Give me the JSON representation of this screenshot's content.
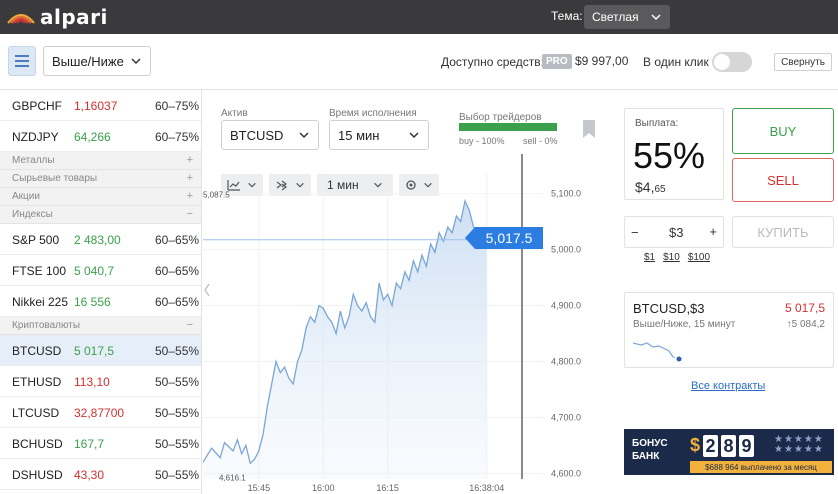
{
  "app": {
    "logo_text": "alpari",
    "theme_label": "Тема:",
    "theme_value": "Светлая"
  },
  "toolbar": {
    "mode_value": "Выше/Ниже",
    "funds_label": "Доступно средств:",
    "pro_badge": "PRO",
    "funds_value": "$9 997,00",
    "one_click_label": "В один клик",
    "one_click_enabled": false,
    "collapse_label": "Свернуть"
  },
  "assets": [
    {
      "type": "asset",
      "name": "GBPCHF",
      "price": "1,16037",
      "price_color": "red",
      "pct": "60–75%"
    },
    {
      "type": "asset",
      "name": "NZDJPY",
      "price": "64,266",
      "price_color": "green",
      "pct": "60–75%"
    },
    {
      "type": "category",
      "name": "Металлы",
      "sign": "+"
    },
    {
      "type": "category",
      "name": "Сырьевые товары",
      "sign": "+"
    },
    {
      "type": "category",
      "name": "Акции",
      "sign": "+"
    },
    {
      "type": "category",
      "name": "Индексы",
      "sign": "−"
    },
    {
      "type": "asset",
      "name": "S&P 500",
      "price": "2 483,00",
      "price_color": "green",
      "pct": "60–65%"
    },
    {
      "type": "asset",
      "name": "FTSE 100",
      "price": "5 040,7",
      "price_color": "green",
      "pct": "60–65%"
    },
    {
      "type": "asset",
      "name": "Nikkei 225",
      "price": "16 556",
      "price_color": "green",
      "pct": "60–65%"
    },
    {
      "type": "category",
      "name": "Криптовалюты",
      "sign": "−"
    },
    {
      "type": "asset",
      "name": "BTCUSD",
      "price": "5 017,5",
      "price_color": "green",
      "pct": "50–55%",
      "selected": true
    },
    {
      "type": "asset",
      "name": "ETHUSD",
      "price": "113,10",
      "price_color": "red",
      "pct": "50–55%"
    },
    {
      "type": "asset",
      "name": "LTCUSD",
      "price": "32,87700",
      "price_color": "red",
      "pct": "50–55%"
    },
    {
      "type": "asset",
      "name": "BCHUSD",
      "price": "167,7",
      "price_color": "green",
      "pct": "50–55%"
    },
    {
      "type": "asset",
      "name": "DSHUSD",
      "price": "43,30",
      "price_color": "red",
      "pct": "50–55%"
    }
  ],
  "chart_panel": {
    "asset_label": "Актив",
    "asset_value": "BTCUSD",
    "time_label": "Время исполнения",
    "time_value": "15 мин",
    "sentiment_title": "Выбор трейдеров",
    "sentiment_buy": "buy - 100%",
    "sentiment_sell": "sell - 0%",
    "sentiment_buy_fraction": 1.0,
    "interval_value": "1 мин"
  },
  "chart_data": {
    "type": "area",
    "y_ticks": [
      "5,100.0",
      "5,000.0",
      "4,900.0",
      "4,800.0",
      "4,700.0",
      "4,600.0"
    ],
    "y_tick_values": [
      5100,
      5000,
      4900,
      4800,
      4700,
      4600
    ],
    "ylim": [
      4590,
      5135
    ],
    "x_ticks": [
      "15:45",
      "16:00",
      "16:15",
      "16:38:04"
    ],
    "x_tick_values": [
      0,
      15,
      30,
      53.07
    ],
    "xlim": [
      -13,
      82
    ],
    "current_price": "5,017.5",
    "current_value": 5017.5,
    "high_label": "5,087.5",
    "high_value": 5087.5,
    "low_label": "4,616.1",
    "low_value": 4616.1,
    "x_minutes": [
      -13,
      -11,
      -9,
      -8,
      -6,
      -5,
      -4,
      -3,
      -2,
      -1,
      0,
      1,
      2,
      3,
      4,
      5,
      6,
      7,
      8,
      9,
      10,
      11,
      12,
      13,
      14,
      15,
      16,
      17,
      18,
      19,
      20,
      21,
      22,
      23,
      24,
      25,
      26,
      27,
      28,
      29,
      30,
      31,
      32,
      33,
      34,
      35,
      36,
      37,
      38,
      39,
      40,
      41,
      42,
      43,
      44,
      45,
      46,
      47,
      48,
      49,
      50,
      51,
      52,
      53
    ],
    "values": [
      4620,
      4645,
      4628,
      4655,
      4640,
      4660,
      4635,
      4650,
      4618,
      4625,
      4640,
      4670,
      4720,
      4760,
      4800,
      4780,
      4790,
      4770,
      4760,
      4800,
      4820,
      4860,
      4880,
      4870,
      4900,
      4895,
      4880,
      4870,
      4850,
      4890,
      4860,
      4880,
      4920,
      4900,
      4890,
      4905,
      4880,
      4870,
      4940,
      4910,
      4920,
      4900,
      4940,
      4930,
      4960,
      4945,
      4980,
      4960,
      4990,
      4970,
      5010,
      4995,
      5030,
      5015,
      5040,
      5030,
      5060,
      5050,
      5087,
      5070,
      5040,
      5030,
      5020,
      5017.5
    ]
  },
  "trade": {
    "payout_label": "Выплата:",
    "payout_pct": "55%",
    "payout_amount_main": "$4,",
    "payout_amount_cents": "65",
    "buy_label": "BUY",
    "sell_label": "SELL",
    "stepper_minus": "−",
    "stepper_value": "$3",
    "stepper_plus": "+",
    "quick_amounts": [
      "$1",
      "$10",
      "$100"
    ],
    "buy_big_label": "КУПИТЬ",
    "contract_name": "BTCUSD,$3",
    "contract_sub": "Выше/Ниже, 15 минут",
    "contract_value": "5 017,5",
    "contract_base": "↑5 084,2",
    "all_contracts": "Все контракты"
  },
  "bonus": {
    "title_line1": "БОНУС",
    "title_line2": "БАНК",
    "currency": "$",
    "digits": [
      "2",
      "8",
      "9"
    ],
    "paid_text": "$688 964 выплачено за месяц"
  },
  "colors": {
    "green": "#3aa04b",
    "red": "#d4302f",
    "accent_blue": "#2b7de1",
    "topbar": "#3a3a3c"
  }
}
